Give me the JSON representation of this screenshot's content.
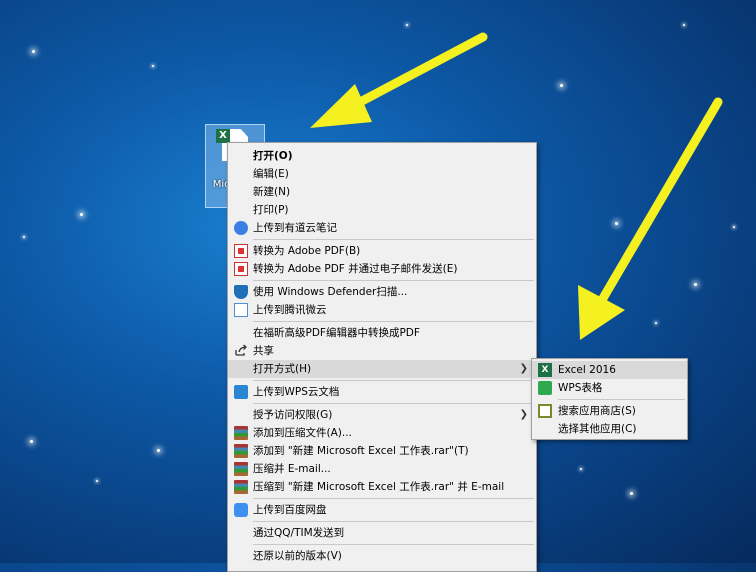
{
  "desktop_icon": {
    "label": "Mic Excel"
  },
  "context_menu": {
    "items": [
      {
        "label": "打开(O)"
      },
      {
        "label": "编辑(E)"
      },
      {
        "label": "新建(N)"
      },
      {
        "label": "打印(P)"
      },
      {
        "label": "上传到有道云笔记"
      },
      {
        "label": "转换为 Adobe PDF(B)"
      },
      {
        "label": "转换为 Adobe PDF 并通过电子邮件发送(E)"
      },
      {
        "label": "使用 Windows Defender扫描..."
      },
      {
        "label": "上传到腾讯微云"
      },
      {
        "label": "在福昕高级PDF编辑器中转换成PDF"
      },
      {
        "label": "共享"
      },
      {
        "label": "打开方式(H)"
      },
      {
        "label": "上传到WPS云文档"
      },
      {
        "label": "授予访问权限(G)"
      },
      {
        "label": "添加到压缩文件(A)..."
      },
      {
        "label": "添加到 \"新建 Microsoft Excel 工作表.rar\"(T)"
      },
      {
        "label": "压缩并 E-mail..."
      },
      {
        "label": "压缩到 \"新建 Microsoft Excel 工作表.rar\" 并 E-mail"
      },
      {
        "label": "上传到百度网盘"
      },
      {
        "label": "通过QQ/TIM发送到"
      },
      {
        "label": "还原以前的版本(V)"
      }
    ]
  },
  "open_with_submenu": {
    "items": [
      {
        "label": "Excel 2016"
      },
      {
        "label": "WPS表格"
      },
      {
        "label": "搜索应用商店(S)"
      },
      {
        "label": "选择其他应用(C)"
      }
    ]
  },
  "colors": {
    "arrow": "#f5f020",
    "highlight": "#d9d9d9",
    "excel_green": "#1e7145"
  }
}
